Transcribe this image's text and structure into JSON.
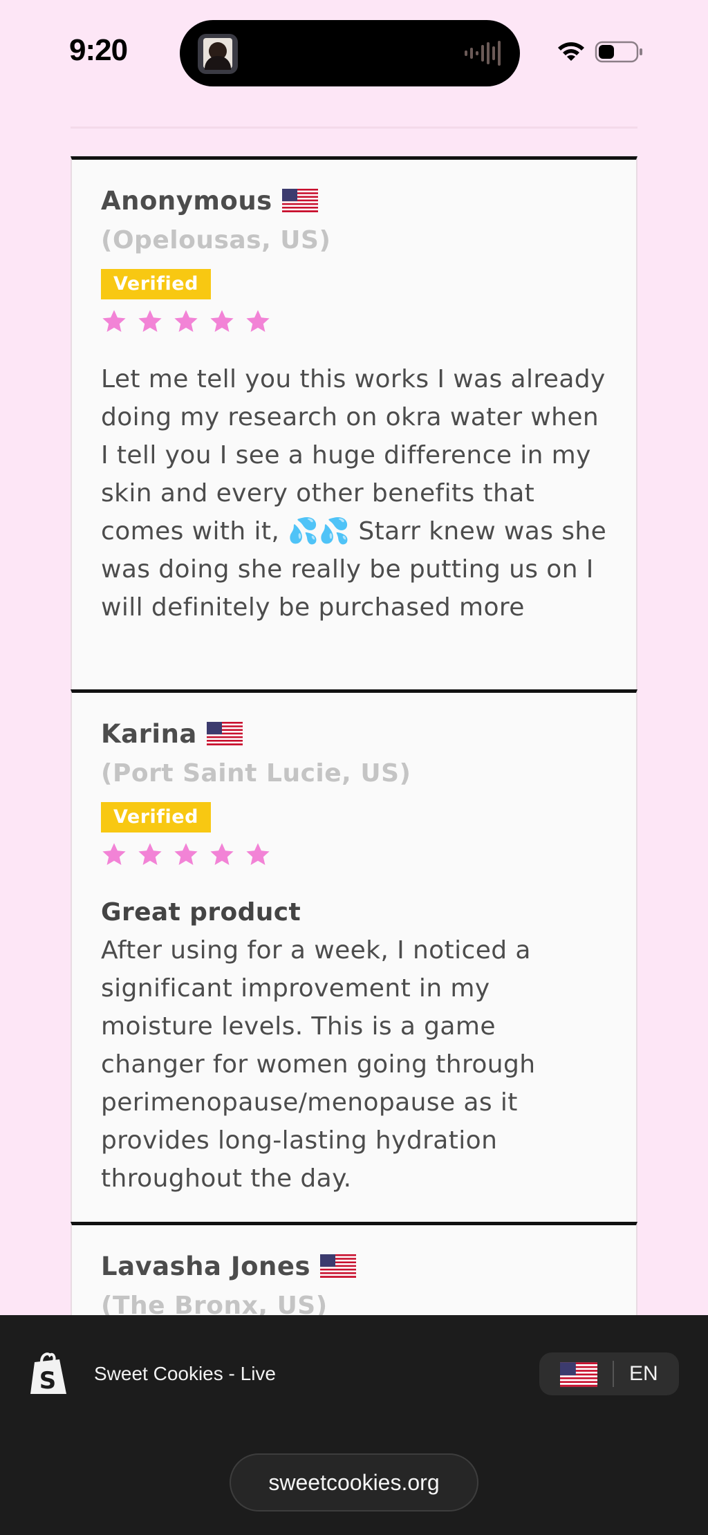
{
  "status_bar": {
    "time": "9:20",
    "icons": [
      "wifi-icon",
      "battery-icon"
    ]
  },
  "colors": {
    "page_background": "#fde6f6",
    "star": "#f283d6",
    "verified_badge": "#f8c812",
    "card_border_top": "#111111",
    "browser_bar": "#1c1c1c"
  },
  "reviews": [
    {
      "author": "Anonymous",
      "location": "(Opelousas, US)",
      "country_flag": "us-flag-icon",
      "badge": "Verified",
      "rating": 5,
      "title": "",
      "body": "Let me tell you this works I was already doing my research on okra water when I tell you I see a huge difference in my skin and every other benefits that comes with it, 💦💦 Starr knew was she was doing she really be putting us on I will definitely be purchased more"
    },
    {
      "author": "Karina",
      "location": "(Port Saint Lucie, US)",
      "country_flag": "us-flag-icon",
      "badge": "Verified",
      "rating": 5,
      "title": "Great product",
      "body": "After using for a week, I noticed a significant improvement in my moisture levels. This is a game changer for women going through perimenopause/menopause as it provides long-lasting hydration throughout the day."
    },
    {
      "author": "Lavasha Jones",
      "location": "(The Bronx, US)",
      "country_flag": "us-flag-icon"
    }
  ],
  "browser": {
    "site_name": "Sweet Cookies - Live",
    "language": "EN",
    "url": "sweetcookies.org"
  }
}
